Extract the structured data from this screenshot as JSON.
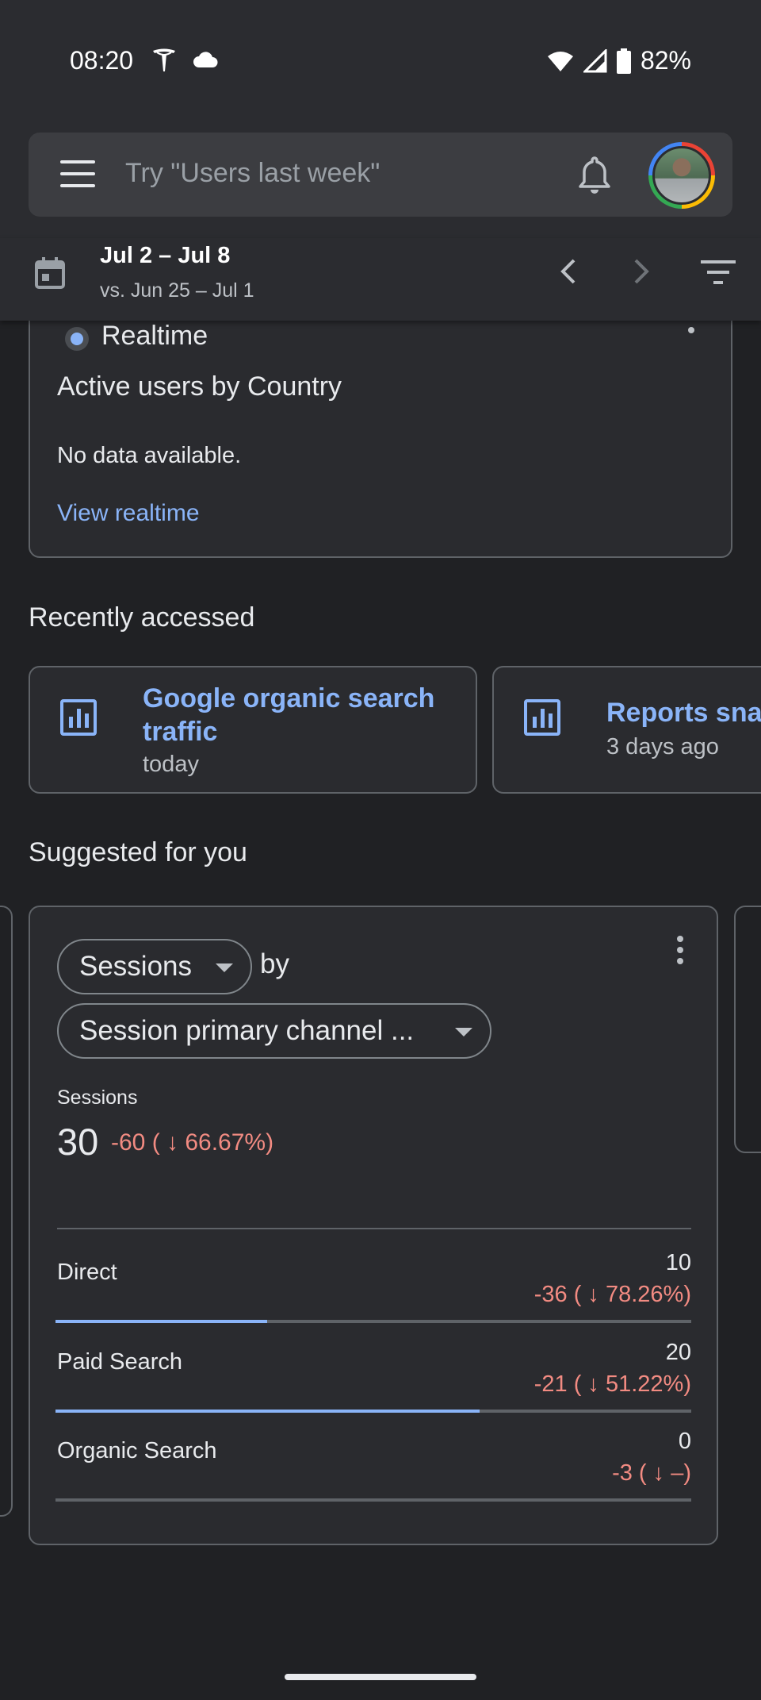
{
  "status_bar": {
    "time": "08:20",
    "battery": "82%"
  },
  "search": {
    "placeholder": "Try \"Users last week\""
  },
  "date_range": {
    "main": "Jul 2 – Jul 8",
    "compare": "vs. Jun 25 – Jul 1"
  },
  "realtime": {
    "label": "Realtime",
    "title": "Active users by Country",
    "empty_text": "No data available.",
    "link": "View realtime"
  },
  "recently_accessed": {
    "title": "Recently accessed",
    "items": [
      {
        "title_line1": "Google organic search",
        "title_line2": "traffic",
        "subtitle": "today",
        "icon": "chart-icon"
      },
      {
        "title_line1": "Reports sna",
        "subtitle": "3 days ago",
        "icon": "chart-icon"
      }
    ]
  },
  "suggested": {
    "title": "Suggested for you",
    "metric_chip": "Sessions",
    "by": "by",
    "dimension_chip": "Session primary channel ...",
    "metric_label": "Sessions",
    "metric_value": "30",
    "metric_delta": "-60 ( ↓ 66.67%)",
    "rows": [
      {
        "label": "Direct",
        "value": "10",
        "delta": "-36 ( ↓ 78.26%)",
        "share": 0.333
      },
      {
        "label": "Paid Search",
        "value": "20",
        "delta": "-21 ( ↓ 51.22%)",
        "share": 0.667
      },
      {
        "label": "Organic Search",
        "value": "0",
        "delta": "-3 ( ↓ –)",
        "share": 0.0
      }
    ]
  },
  "colors": {
    "accent": "#8ab4f8",
    "negative": "#f28b82",
    "background": "#202124",
    "surface": "#2a2b2f"
  }
}
